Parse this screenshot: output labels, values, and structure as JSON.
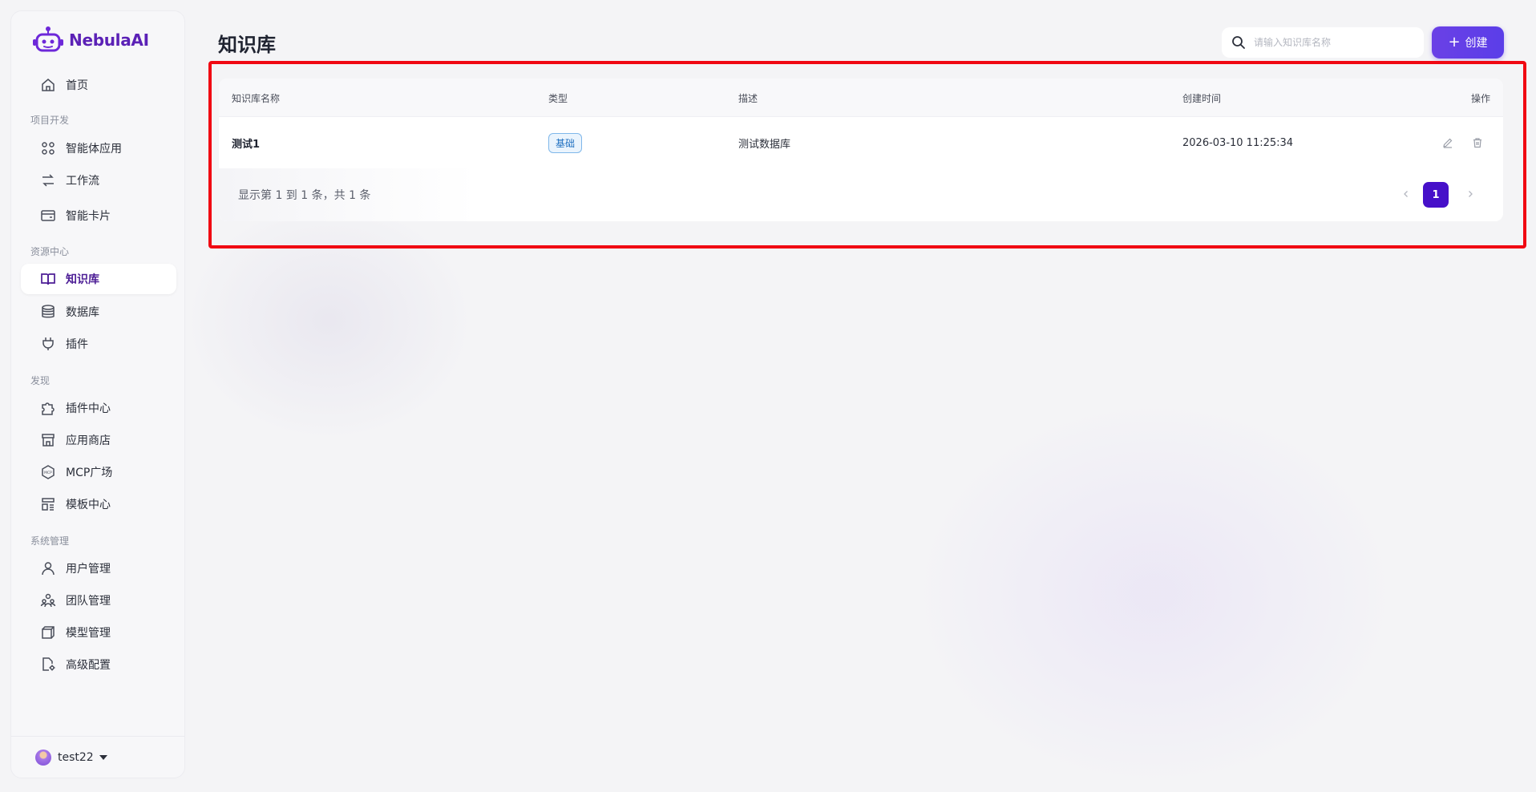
{
  "app": {
    "name": "NebulaAI"
  },
  "sidebar": {
    "items": [
      {
        "label": "首页",
        "icon": "home-icon"
      },
      {
        "label": "智能体应用",
        "icon": "grid-icon"
      },
      {
        "label": "工作流",
        "icon": "workflow-icon"
      },
      {
        "label": "智能卡片",
        "icon": "card-icon"
      },
      {
        "label": "知识库",
        "icon": "book-icon",
        "active": true
      },
      {
        "label": "数据库",
        "icon": "database-icon"
      },
      {
        "label": "插件",
        "icon": "plug-icon"
      },
      {
        "label": "插件中心",
        "icon": "puzzle-icon"
      },
      {
        "label": "应用商店",
        "icon": "store-icon"
      },
      {
        "label": "MCP广场",
        "icon": "mcp-icon"
      },
      {
        "label": "模板中心",
        "icon": "template-icon"
      },
      {
        "label": "用户管理",
        "icon": "user-icon"
      },
      {
        "label": "团队管理",
        "icon": "team-icon"
      },
      {
        "label": "模型管理",
        "icon": "model-icon"
      },
      {
        "label": "高级配置",
        "icon": "settings-file-icon"
      }
    ],
    "sections": {
      "project_dev": "项目开发",
      "resource_center": "资源中心",
      "discover": "发现",
      "system_admin": "系统管理"
    },
    "user": {
      "name": "test22"
    }
  },
  "header": {
    "title": "知识库",
    "search_placeholder": "请输入知识库名称",
    "create_label": "创建"
  },
  "table": {
    "columns": [
      "知识库名称",
      "类型",
      "描述",
      "创建时间",
      "操作"
    ],
    "rows": [
      {
        "name": "测试1",
        "type": "基础",
        "description": "测试数据库",
        "created_at": "2026-03-10 11:25:34"
      }
    ]
  },
  "pagination": {
    "summary": "显示第 1 到 1 条，共 1 条",
    "current_page": "1"
  },
  "colors": {
    "brand": "#5b21b6",
    "primary_button": "#5b3ee8",
    "active_page": "#4610c9",
    "highlight_border": "#f00812",
    "badge_border": "#7fb7ea"
  }
}
